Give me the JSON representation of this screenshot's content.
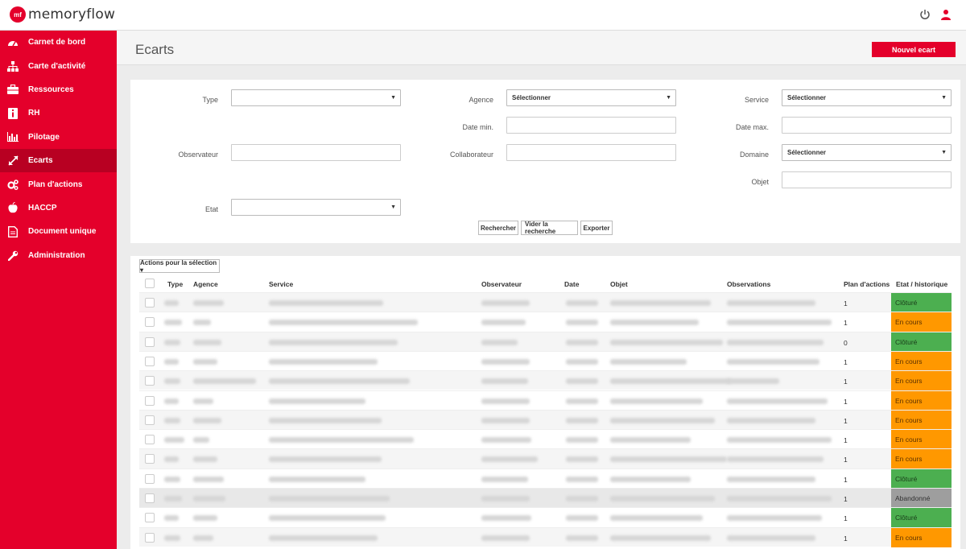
{
  "app": {
    "logo_mark": "mf",
    "logo_text": "memoryflow"
  },
  "sidebar": {
    "items": [
      {
        "label": "Carnet de bord",
        "icon": "dashboard-icon",
        "active": false
      },
      {
        "label": "Carte d'activité",
        "icon": "sitemap-icon",
        "active": false
      },
      {
        "label": "Ressources",
        "icon": "briefcase-icon",
        "active": false
      },
      {
        "label": "RH",
        "icon": "info-icon",
        "active": false
      },
      {
        "label": "Pilotage",
        "icon": "bar-chart-icon",
        "active": false
      },
      {
        "label": "Ecarts",
        "icon": "expand-arrows-icon",
        "active": true
      },
      {
        "label": "Plan d'actions",
        "icon": "cogs-icon",
        "active": false
      },
      {
        "label": "HACCP",
        "icon": "apple-icon",
        "active": false
      },
      {
        "label": "Document unique",
        "icon": "document-icon",
        "active": false
      },
      {
        "label": "Administration",
        "icon": "wrench-icon",
        "active": false
      }
    ]
  },
  "header": {
    "title": "Ecarts",
    "new_button": "Nouvel ecart"
  },
  "filters": {
    "type_label": "Type",
    "agence_label": "Agence",
    "agence_value": "Sélectionner",
    "service_label": "Service",
    "service_value": "Sélectionner",
    "date_min_label": "Date min.",
    "date_max_label": "Date max.",
    "observateur_label": "Observateur",
    "collaborateur_label": "Collaborateur",
    "domaine_label": "Domaine",
    "domaine_value": "Sélectionner",
    "objet_label": "Objet",
    "etat_label": "Etat",
    "search_button": "Rechercher",
    "clear_button": "Vider la recherche",
    "export_button": "Exporter"
  },
  "table": {
    "actions_button": "Actions pour la sélection ▾",
    "columns": [
      "Type",
      "Agence",
      "Service",
      "Observateur",
      "Date",
      "Objet",
      "Observations",
      "Plan d'actions",
      "Etat / historique"
    ],
    "rows": [
      {
        "plan": "1",
        "status": "Clôturé",
        "kind": "clot"
      },
      {
        "plan": "1",
        "status": "En cours",
        "kind": "cours"
      },
      {
        "plan": "0",
        "status": "Clôturé",
        "kind": "clot"
      },
      {
        "plan": "1",
        "status": "En cours",
        "kind": "cours"
      },
      {
        "plan": "1",
        "status": "En cours",
        "kind": "cours"
      },
      {
        "plan": "1",
        "status": "En cours",
        "kind": "cours"
      },
      {
        "plan": "1",
        "status": "En cours",
        "kind": "cours"
      },
      {
        "plan": "1",
        "status": "En cours",
        "kind": "cours"
      },
      {
        "plan": "1",
        "status": "En cours",
        "kind": "cours"
      },
      {
        "plan": "1",
        "status": "Clôturé",
        "kind": "clot"
      },
      {
        "plan": "1",
        "status": "Abandonné",
        "kind": "aband"
      },
      {
        "plan": "1",
        "status": "Clôturé",
        "kind": "clot"
      },
      {
        "plan": "1",
        "status": "En cours",
        "kind": "cours"
      }
    ]
  },
  "colors": {
    "brand": "#e4002b",
    "active_nav": "#b80022",
    "status_closed": "#4caf50",
    "status_in_progress": "#ff9800",
    "status_abandoned": "#9e9e9e"
  }
}
